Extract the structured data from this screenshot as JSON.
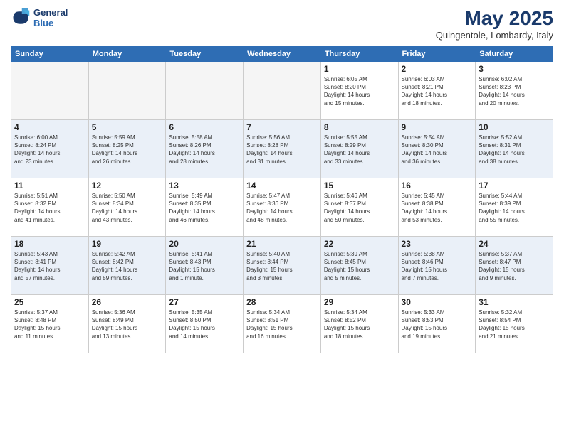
{
  "logo": {
    "line1": "General",
    "line2": "Blue"
  },
  "title": "May 2025",
  "subtitle": "Quingentole, Lombardy, Italy",
  "days_of_week": [
    "Sunday",
    "Monday",
    "Tuesday",
    "Wednesday",
    "Thursday",
    "Friday",
    "Saturday"
  ],
  "weeks": [
    [
      {
        "day": "",
        "info": ""
      },
      {
        "day": "",
        "info": ""
      },
      {
        "day": "",
        "info": ""
      },
      {
        "day": "",
        "info": ""
      },
      {
        "day": "1",
        "info": "Sunrise: 6:05 AM\nSunset: 8:20 PM\nDaylight: 14 hours\nand 15 minutes."
      },
      {
        "day": "2",
        "info": "Sunrise: 6:03 AM\nSunset: 8:21 PM\nDaylight: 14 hours\nand 18 minutes."
      },
      {
        "day": "3",
        "info": "Sunrise: 6:02 AM\nSunset: 8:23 PM\nDaylight: 14 hours\nand 20 minutes."
      }
    ],
    [
      {
        "day": "4",
        "info": "Sunrise: 6:00 AM\nSunset: 8:24 PM\nDaylight: 14 hours\nand 23 minutes."
      },
      {
        "day": "5",
        "info": "Sunrise: 5:59 AM\nSunset: 8:25 PM\nDaylight: 14 hours\nand 26 minutes."
      },
      {
        "day": "6",
        "info": "Sunrise: 5:58 AM\nSunset: 8:26 PM\nDaylight: 14 hours\nand 28 minutes."
      },
      {
        "day": "7",
        "info": "Sunrise: 5:56 AM\nSunset: 8:28 PM\nDaylight: 14 hours\nand 31 minutes."
      },
      {
        "day": "8",
        "info": "Sunrise: 5:55 AM\nSunset: 8:29 PM\nDaylight: 14 hours\nand 33 minutes."
      },
      {
        "day": "9",
        "info": "Sunrise: 5:54 AM\nSunset: 8:30 PM\nDaylight: 14 hours\nand 36 minutes."
      },
      {
        "day": "10",
        "info": "Sunrise: 5:52 AM\nSunset: 8:31 PM\nDaylight: 14 hours\nand 38 minutes."
      }
    ],
    [
      {
        "day": "11",
        "info": "Sunrise: 5:51 AM\nSunset: 8:32 PM\nDaylight: 14 hours\nand 41 minutes."
      },
      {
        "day": "12",
        "info": "Sunrise: 5:50 AM\nSunset: 8:34 PM\nDaylight: 14 hours\nand 43 minutes."
      },
      {
        "day": "13",
        "info": "Sunrise: 5:49 AM\nSunset: 8:35 PM\nDaylight: 14 hours\nand 46 minutes."
      },
      {
        "day": "14",
        "info": "Sunrise: 5:47 AM\nSunset: 8:36 PM\nDaylight: 14 hours\nand 48 minutes."
      },
      {
        "day": "15",
        "info": "Sunrise: 5:46 AM\nSunset: 8:37 PM\nDaylight: 14 hours\nand 50 minutes."
      },
      {
        "day": "16",
        "info": "Sunrise: 5:45 AM\nSunset: 8:38 PM\nDaylight: 14 hours\nand 53 minutes."
      },
      {
        "day": "17",
        "info": "Sunrise: 5:44 AM\nSunset: 8:39 PM\nDaylight: 14 hours\nand 55 minutes."
      }
    ],
    [
      {
        "day": "18",
        "info": "Sunrise: 5:43 AM\nSunset: 8:41 PM\nDaylight: 14 hours\nand 57 minutes."
      },
      {
        "day": "19",
        "info": "Sunrise: 5:42 AM\nSunset: 8:42 PM\nDaylight: 14 hours\nand 59 minutes."
      },
      {
        "day": "20",
        "info": "Sunrise: 5:41 AM\nSunset: 8:43 PM\nDaylight: 15 hours\nand 1 minute."
      },
      {
        "day": "21",
        "info": "Sunrise: 5:40 AM\nSunset: 8:44 PM\nDaylight: 15 hours\nand 3 minutes."
      },
      {
        "day": "22",
        "info": "Sunrise: 5:39 AM\nSunset: 8:45 PM\nDaylight: 15 hours\nand 5 minutes."
      },
      {
        "day": "23",
        "info": "Sunrise: 5:38 AM\nSunset: 8:46 PM\nDaylight: 15 hours\nand 7 minutes."
      },
      {
        "day": "24",
        "info": "Sunrise: 5:37 AM\nSunset: 8:47 PM\nDaylight: 15 hours\nand 9 minutes."
      }
    ],
    [
      {
        "day": "25",
        "info": "Sunrise: 5:37 AM\nSunset: 8:48 PM\nDaylight: 15 hours\nand 11 minutes."
      },
      {
        "day": "26",
        "info": "Sunrise: 5:36 AM\nSunset: 8:49 PM\nDaylight: 15 hours\nand 13 minutes."
      },
      {
        "day": "27",
        "info": "Sunrise: 5:35 AM\nSunset: 8:50 PM\nDaylight: 15 hours\nand 14 minutes."
      },
      {
        "day": "28",
        "info": "Sunrise: 5:34 AM\nSunset: 8:51 PM\nDaylight: 15 hours\nand 16 minutes."
      },
      {
        "day": "29",
        "info": "Sunrise: 5:34 AM\nSunset: 8:52 PM\nDaylight: 15 hours\nand 18 minutes."
      },
      {
        "day": "30",
        "info": "Sunrise: 5:33 AM\nSunset: 8:53 PM\nDaylight: 15 hours\nand 19 minutes."
      },
      {
        "day": "31",
        "info": "Sunrise: 5:32 AM\nSunset: 8:54 PM\nDaylight: 15 hours\nand 21 minutes."
      }
    ]
  ]
}
